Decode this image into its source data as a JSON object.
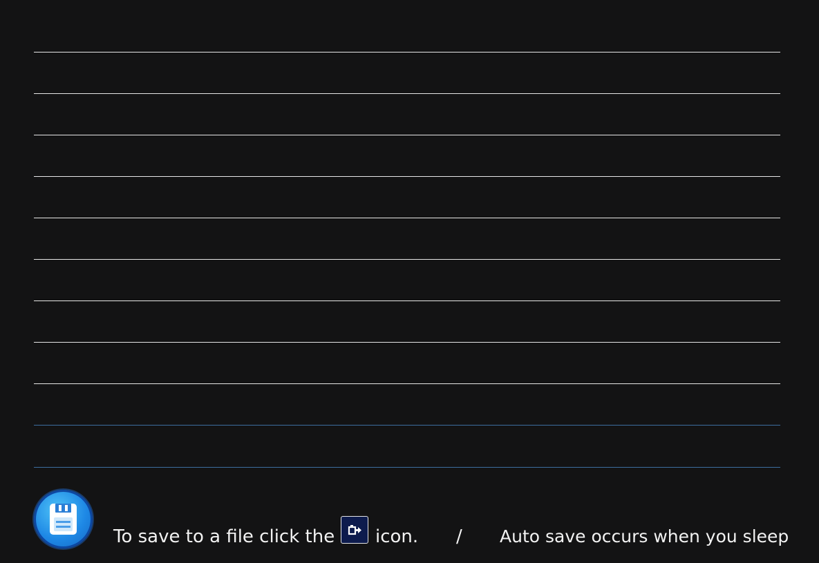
{
  "footer": {
    "hint_before": "To save to a file click the",
    "hint_after": "icon.",
    "separator": "/",
    "auto_save": "Auto save occurs when you sleep"
  },
  "icons": {
    "badge": "floppy-disk-icon",
    "inline": "export-to-file-icon"
  },
  "colors": {
    "background": "#131314",
    "rule": "#e8e8e8",
    "rule_highlight": "#3d6fa0",
    "badge": "#1e88e5",
    "inline_icon": "#0d1b4d"
  }
}
